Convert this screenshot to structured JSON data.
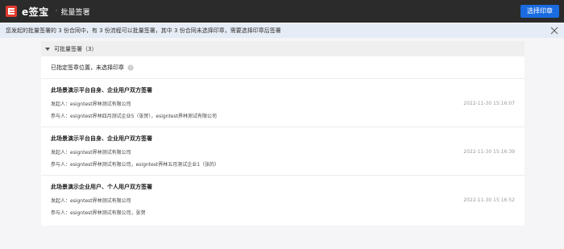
{
  "header": {
    "logo_text": "e签宝",
    "separator": "·",
    "title": "批量签署",
    "choose_seal_button": "选择印章"
  },
  "notice": {
    "text": "您发起的批量签署的 3 份合同中，有 3 份流程可以批量签署，其中 3 份合同未选择印章，需要选择印章后签署"
  },
  "group": {
    "label": "可批量签署（3）",
    "sub_label": "已指定签章位置，未选择印章"
  },
  "items": [
    {
      "title": "此场景演示平台自身、企业用户双方签署",
      "initiator": "发起人：esigntest界林测试有限公司",
      "participants": "参与人：esigntest界林四月测试企业5（张贺），esigntest界林测试有限公司",
      "time": "2022-11-30 15:16:07"
    },
    {
      "title": "此场景演示平台自身、企业用户双方签署",
      "initiator": "发起人：esigntest界林测试有限公司",
      "participants": "参与人：esigntest界林测试有限公司，esigntest界林五月测试企业1（张的）",
      "time": "2022-11-30 15:16:39"
    },
    {
      "title": "此场景演示企业用户、个人用户双方签署",
      "initiator": "发起人：esigntest界林测试有限公司",
      "participants": "参与人：esigntest界林测试有限公司，张贺",
      "time": "2022-11-30 15:16:52"
    }
  ]
}
